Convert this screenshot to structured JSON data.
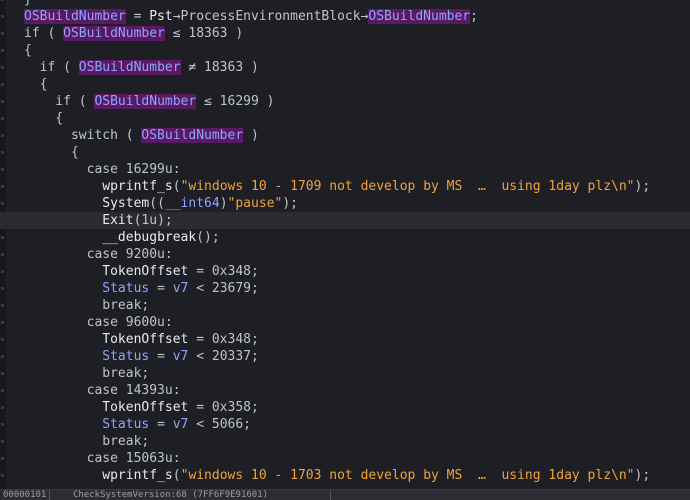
{
  "lines": [
    [
      {
        "t": "}",
        "c": "op"
      }
    ],
    [
      {
        "t": "OSBuildNumber",
        "c": "glob"
      },
      {
        "t": " = ",
        "c": "op"
      },
      {
        "t": "Pst",
        "c": "var"
      },
      {
        "t": "→ProcessEnvironmentBlock→",
        "c": "op"
      },
      {
        "t": "OSBuildNumber",
        "c": "glob"
      },
      {
        "t": ";",
        "c": "op"
      }
    ],
    [
      {
        "t": "if ( ",
        "c": "kw"
      },
      {
        "t": "OSBuildNumber",
        "c": "glob"
      },
      {
        "t": " ≤ 18363 )",
        "c": "op"
      }
    ],
    [
      {
        "t": "{",
        "c": "op"
      }
    ],
    [
      {
        "t": "  if ( ",
        "c": "kw"
      },
      {
        "t": "OSBuildNumber",
        "c": "glob"
      },
      {
        "t": " ≠ 18363 )",
        "c": "op"
      }
    ],
    [
      {
        "t": "  {",
        "c": "op"
      }
    ],
    [
      {
        "t": "    if ( ",
        "c": "kw"
      },
      {
        "t": "OSBuildNumber",
        "c": "glob"
      },
      {
        "t": " ≤ 16299 )",
        "c": "op"
      }
    ],
    [
      {
        "t": "    {",
        "c": "op"
      }
    ],
    [
      {
        "t": "      switch ( ",
        "c": "kw"
      },
      {
        "t": "OSBuildNumber",
        "c": "glob"
      },
      {
        "t": " )",
        "c": "op"
      }
    ],
    [
      {
        "t": "      {",
        "c": "op"
      }
    ],
    [
      {
        "t": "        case 16299u:",
        "c": "kw"
      }
    ],
    [
      {
        "t": "          ",
        "c": "op"
      },
      {
        "t": "wprintf_s",
        "c": "fn"
      },
      {
        "t": "(",
        "c": "op"
      },
      {
        "t": "\"windows 10 - 1709 not develop by MS  …  using 1day plz\\n\"",
        "c": "str"
      },
      {
        "t": ");",
        "c": "op"
      }
    ],
    [
      {
        "t": "          ",
        "c": "op"
      },
      {
        "t": "System",
        "c": "fn"
      },
      {
        "t": "((",
        "c": "op"
      },
      {
        "t": "__int64",
        "c": "type"
      },
      {
        "t": ")",
        "c": "op"
      },
      {
        "t": "\"pause\"",
        "c": "str"
      },
      {
        "t": ");",
        "c": "op"
      }
    ],
    [
      {
        "t": "          ",
        "c": "op"
      },
      {
        "t": "Exit",
        "c": "fn"
      },
      {
        "t": "(1u);",
        "c": "op"
      }
    ],
    [
      {
        "t": "          ",
        "c": "op"
      },
      {
        "t": "__debugbreak",
        "c": "fn"
      },
      {
        "t": "();",
        "c": "op"
      }
    ],
    [
      {
        "t": "        case 9200u:",
        "c": "kw"
      }
    ],
    [
      {
        "t": "          ",
        "c": "op"
      },
      {
        "t": "TokenOffset",
        "c": "var"
      },
      {
        "t": " = 0x348;",
        "c": "op"
      }
    ],
    [
      {
        "t": "          ",
        "c": "op"
      },
      {
        "t": "Status",
        "c": "blue"
      },
      {
        "t": " = ",
        "c": "op"
      },
      {
        "t": "v7",
        "c": "blue"
      },
      {
        "t": " < 23679;",
        "c": "op"
      }
    ],
    [
      {
        "t": "          break;",
        "c": "kw"
      }
    ],
    [
      {
        "t": "        case 9600u:",
        "c": "kw"
      }
    ],
    [
      {
        "t": "          ",
        "c": "op"
      },
      {
        "t": "TokenOffset",
        "c": "var"
      },
      {
        "t": " = 0x348;",
        "c": "op"
      }
    ],
    [
      {
        "t": "          ",
        "c": "op"
      },
      {
        "t": "Status",
        "c": "blue"
      },
      {
        "t": " = ",
        "c": "op"
      },
      {
        "t": "v7",
        "c": "blue"
      },
      {
        "t": " < 20337;",
        "c": "op"
      }
    ],
    [
      {
        "t": "          break;",
        "c": "kw"
      }
    ],
    [
      {
        "t": "        case 14393u:",
        "c": "kw"
      }
    ],
    [
      {
        "t": "          ",
        "c": "op"
      },
      {
        "t": "TokenOffset",
        "c": "var"
      },
      {
        "t": " = 0x358;",
        "c": "op"
      }
    ],
    [
      {
        "t": "          ",
        "c": "op"
      },
      {
        "t": "Status",
        "c": "blue"
      },
      {
        "t": " = ",
        "c": "op"
      },
      {
        "t": "v7",
        "c": "blue"
      },
      {
        "t": " < 5066;",
        "c": "op"
      }
    ],
    [
      {
        "t": "          break;",
        "c": "kw"
      }
    ],
    [
      {
        "t": "        case 15063u:",
        "c": "kw"
      }
    ],
    [
      {
        "t": "          ",
        "c": "op"
      },
      {
        "t": "wprintf_s",
        "c": "fn"
      },
      {
        "t": "(",
        "c": "op"
      },
      {
        "t": "\"windows 10 - 1703 not develop by MS  …  using 1day plz\\n\"",
        "c": "str"
      },
      {
        "t": ");",
        "c": "op"
      }
    ]
  ],
  "current_line": 13,
  "statusbar": {
    "segments": [
      "00000101",
      "CheckSystemVersion:68 (7FF6F9E91601)"
    ]
  },
  "colors": {
    "background": "#1e1f24",
    "global_highlight": "#5a1a63",
    "string": "#f2a23a",
    "identifier_blue": "#8fa4ff"
  }
}
